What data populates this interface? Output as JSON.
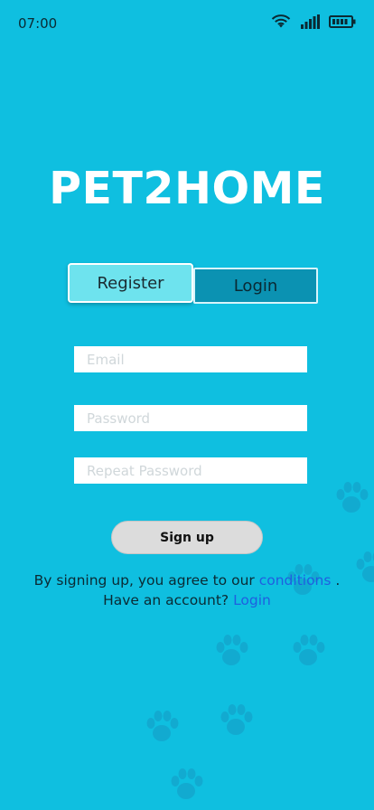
{
  "status_bar": {
    "time": "07:00"
  },
  "app": {
    "logo_text": "PET2HOME"
  },
  "tabs": {
    "register_label": "Register",
    "login_label": "Login"
  },
  "form": {
    "email_placeholder": "Email",
    "password_placeholder": "Password",
    "repeat_password_placeholder": "Repeat Password",
    "signup_label": "Sign up"
  },
  "footer": {
    "terms_prefix": "By signing up, you agree to our",
    "terms_link": "conditions",
    "terms_suffix": ".",
    "account_prefix": "Have an account?",
    "login_link": "Login"
  },
  "colors": {
    "background": "#0fbfe0",
    "link": "#1f5fe0",
    "paw": "#169ac4"
  }
}
